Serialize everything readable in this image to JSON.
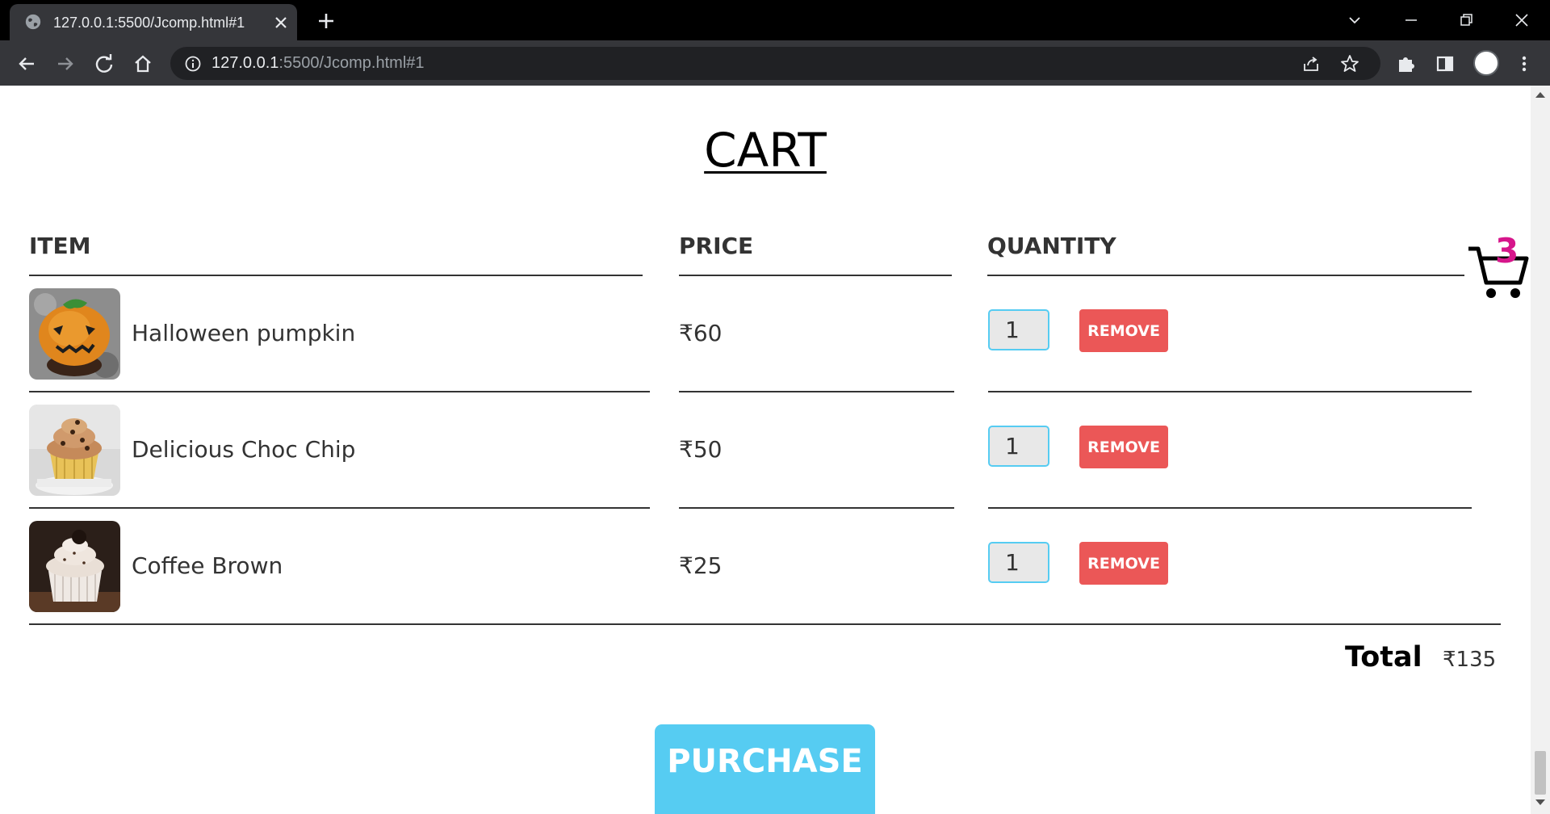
{
  "browser": {
    "tab_title": "127.0.0.1:5500/Jcomp.html#1",
    "url_host": "127.0.0.1",
    "url_path": ":5500/Jcomp.html#1"
  },
  "page": {
    "title": "CART",
    "columns": {
      "item": "ITEM",
      "price": "PRICE",
      "quantity": "QUANTITY"
    },
    "items": [
      {
        "name": "Halloween pumpkin",
        "price": "₹60",
        "quantity": "1",
        "remove_label": "REMOVE",
        "image": "pumpkin-cupcake-image"
      },
      {
        "name": "Delicious Choc Chip",
        "price": "₹50",
        "quantity": "1",
        "remove_label": "REMOVE",
        "image": "choc-chip-cupcake-image"
      },
      {
        "name": "Coffee Brown",
        "price": "₹25",
        "quantity": "1",
        "remove_label": "REMOVE",
        "image": "coffee-cupcake-image"
      }
    ],
    "total_label": "Total",
    "total_value": "₹135",
    "purchase_label": "PURCHASE",
    "cart_count": "3"
  },
  "colors": {
    "remove_button": "#eb5757",
    "purchase_button": "#56ccf2",
    "quantity_border": "#56ccf2",
    "cart_count": "#d6168b"
  }
}
